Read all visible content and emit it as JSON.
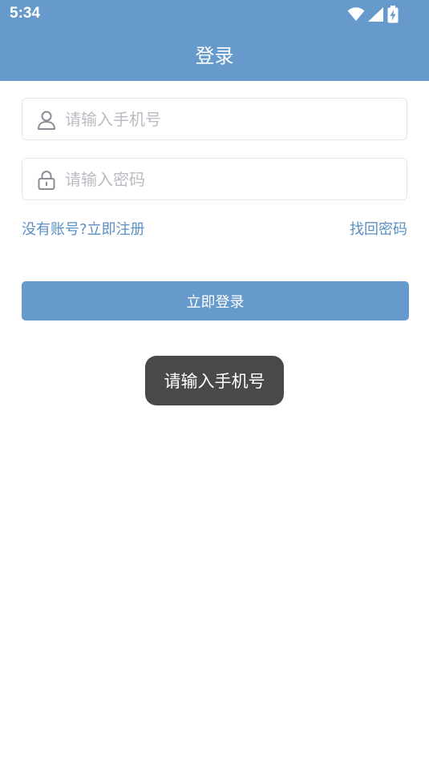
{
  "status_bar": {
    "time": "5:34",
    "icons": [
      "wifi-icon",
      "signal-icon",
      "battery-charging-icon"
    ]
  },
  "header": {
    "title": "登录"
  },
  "form": {
    "phone": {
      "icon": "user-icon",
      "value": "",
      "placeholder": "请输入手机号"
    },
    "password": {
      "icon": "lock-icon",
      "value": "",
      "placeholder": "请输入密码"
    },
    "register_link": "没有账号?立即注册",
    "recover_link": "找回密码",
    "login_button": "立即登录"
  },
  "toast": {
    "message": "请输入手机号"
  },
  "colors": {
    "primary": "#6699cc",
    "link": "#5b8fc2",
    "toast_bg": "#494949",
    "placeholder": "#b9bcc2"
  }
}
